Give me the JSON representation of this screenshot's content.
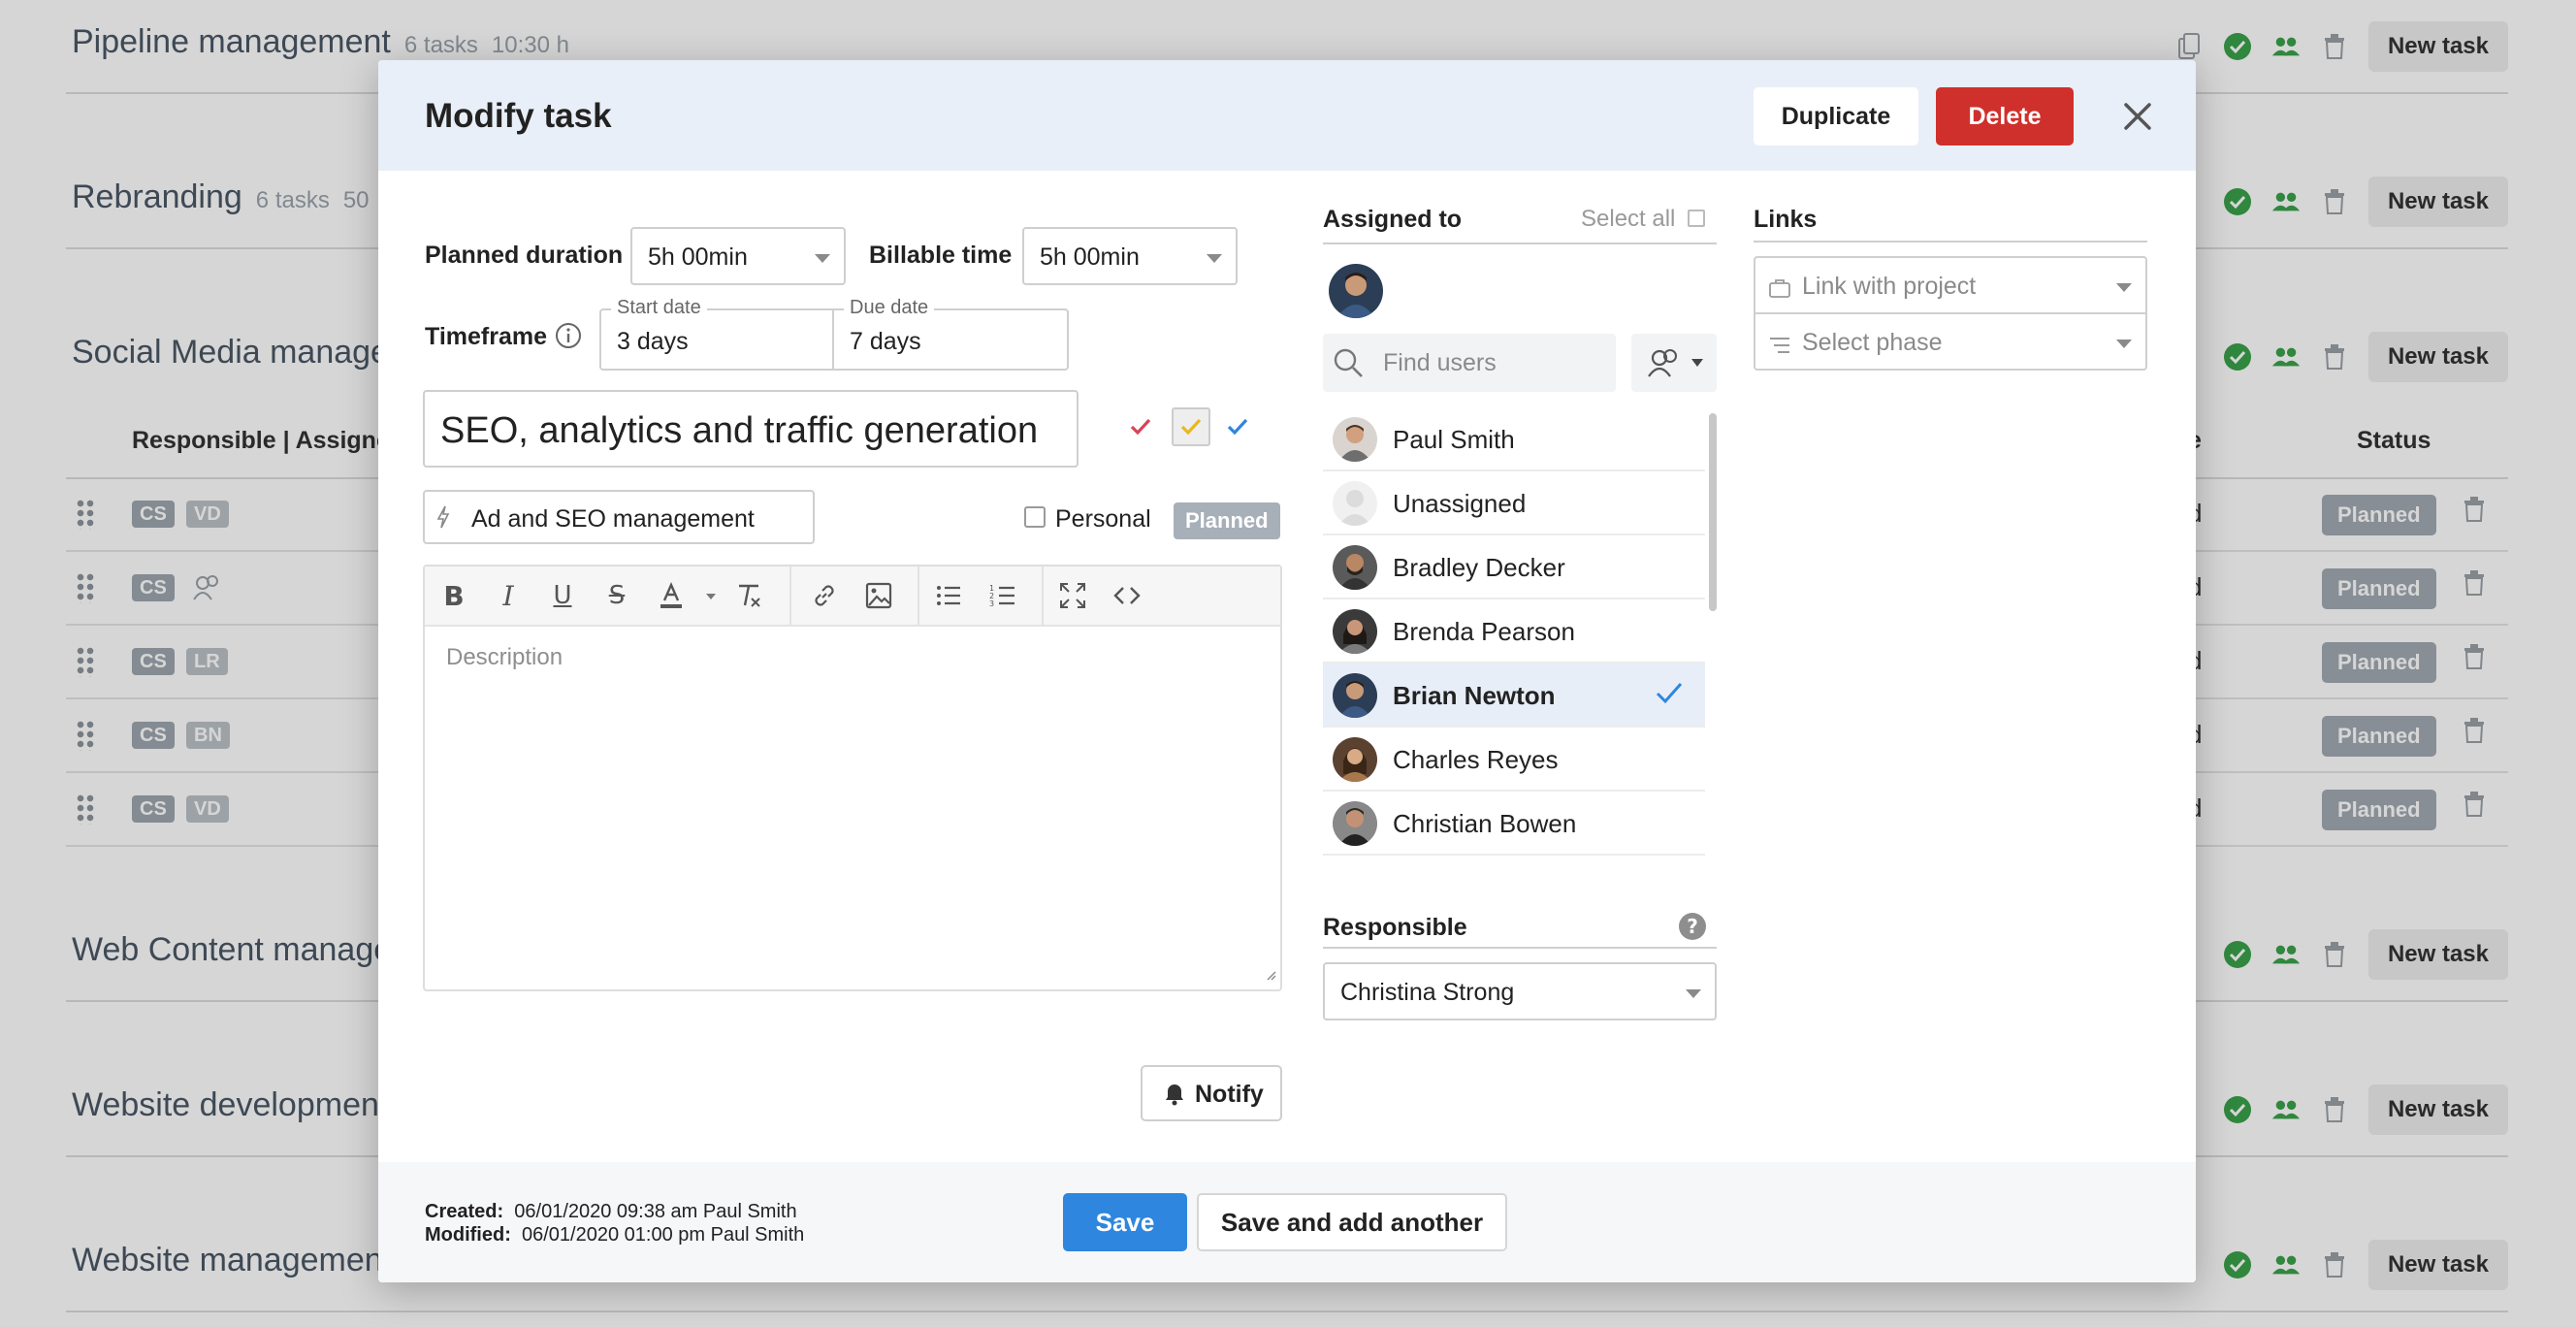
{
  "background": {
    "projects": [
      {
        "title": "Pipeline management",
        "meta1": "6 tasks",
        "meta2": "10:30 h"
      },
      {
        "title": "Rebranding",
        "meta1": "6 tasks",
        "meta2": "50"
      },
      {
        "title": "Social Media manage",
        "meta1": "",
        "meta2": ""
      },
      {
        "title": "Web Content manage",
        "meta1": "",
        "meta2": ""
      },
      {
        "title": "Website developmen",
        "meta1": "",
        "meta2": ""
      },
      {
        "title": "Website managemen",
        "meta1": "",
        "meta2": ""
      }
    ],
    "new_task_label": "New task",
    "table_headers": {
      "responsible": "Responsible | Assigne",
      "date_tail": "e",
      "status": "Status"
    },
    "task_rows": [
      {
        "chip1": "CS",
        "chip2": "VD",
        "date_tail": "d",
        "status": "Planned"
      },
      {
        "chip1": "CS",
        "chip2": "",
        "date_tail": "d",
        "status": "Planned"
      },
      {
        "chip1": "CS",
        "chip2": "LR",
        "date_tail": "d",
        "status": "Planned"
      },
      {
        "chip1": "CS",
        "chip2": "BN",
        "date_tail": "d",
        "status": "Planned"
      },
      {
        "chip1": "CS",
        "chip2": "VD",
        "date_tail": "d",
        "status": "Planned"
      }
    ]
  },
  "modal": {
    "title": "Modify task",
    "duplicate_label": "Duplicate",
    "delete_label": "Delete",
    "planned_duration_label": "Planned duration",
    "planned_duration_value": "5h 00min",
    "billable_time_label": "Billable time",
    "billable_time_value": "5h 00min",
    "timeframe_label": "Timeframe",
    "start_date_label": "Start date",
    "start_date_value": "3 days",
    "due_date_label": "Due date",
    "due_date_value": "7 days",
    "task_name": "SEO, analytics and traffic generation",
    "task_list": "Ad and SEO management",
    "personal_label": "Personal",
    "status_badge": "Planned",
    "description_placeholder": "Description",
    "notify_label": "Notify",
    "assigned_to_label": "Assigned to",
    "select_all_label": "Select all",
    "find_users_placeholder": "Find users",
    "users": [
      {
        "name": "Paul Smith",
        "selected": false
      },
      {
        "name": "Unassigned",
        "selected": false
      },
      {
        "name": "Bradley Decker",
        "selected": false
      },
      {
        "name": "Brenda Pearson",
        "selected": false
      },
      {
        "name": "Brian Newton",
        "selected": true
      },
      {
        "name": "Charles Reyes",
        "selected": false
      },
      {
        "name": "Christian Bowen",
        "selected": false
      }
    ],
    "responsible_label": "Responsible",
    "responsible_value": "Christina Strong",
    "links_label": "Links",
    "link_project_placeholder": "Link with project",
    "select_phase_placeholder": "Select phase",
    "created_label": "Created:",
    "created_value": "06/01/2020 09:38 am Paul Smith",
    "modified_label": "Modified:",
    "modified_value": "06/01/2020 01:00 pm Paul Smith",
    "save_label": "Save",
    "save_add_label": "Save and add another"
  },
  "colors": {
    "accent_blue": "#2e86de",
    "delete_red": "#d0302c",
    "success_green": "#3aa14a",
    "header_bg": "#e9eff8"
  }
}
